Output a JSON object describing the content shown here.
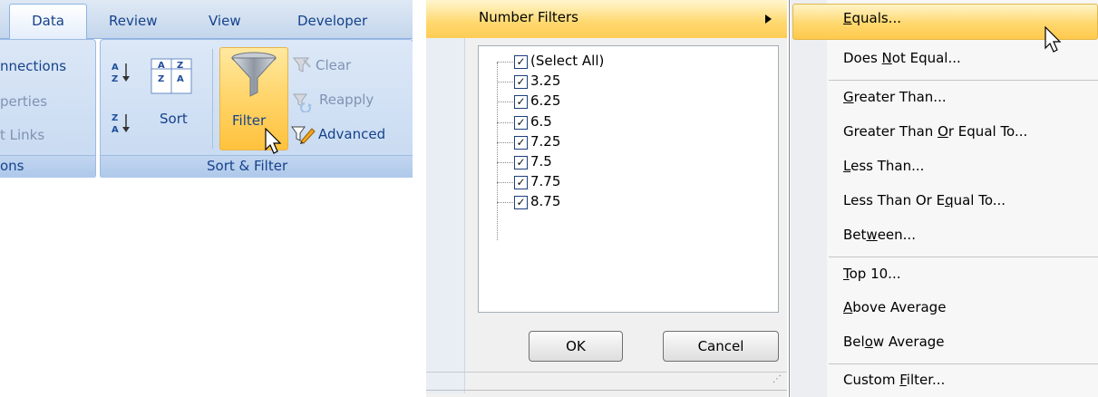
{
  "ribbon": {
    "tabs": [
      "Data",
      "Review",
      "View",
      "Developer"
    ],
    "connections_group": {
      "items": [
        "nnections",
        "perties",
        "t Links"
      ],
      "group_label": "ons"
    },
    "sort_filter_group": {
      "sort_label": "Sort",
      "filter_label": "Filter",
      "clear_label": "Clear",
      "reapply_label": "Reapply",
      "advanced_label": "Advanced",
      "group_label": "Sort & Filter"
    }
  },
  "filter_dropdown": {
    "number_filters_label": "Number Filters",
    "values": [
      {
        "label": "(Select All)",
        "checked": true
      },
      {
        "label": "3.25",
        "checked": true
      },
      {
        "label": "6.25",
        "checked": true
      },
      {
        "label": "6.5",
        "checked": true
      },
      {
        "label": "7.25",
        "checked": true
      },
      {
        "label": "7.5",
        "checked": true
      },
      {
        "label": "7.75",
        "checked": true
      },
      {
        "label": "8.75",
        "checked": true
      }
    ],
    "ok_label": "OK",
    "cancel_label": "Cancel"
  },
  "number_filters_menu": {
    "items": [
      {
        "label": "Equals...",
        "highlighted": true
      },
      {
        "label": "Does Not Equal..."
      },
      {
        "label": "Greater Than..."
      },
      {
        "label": "Greater Than Or Equal To..."
      },
      {
        "label": "Less Than..."
      },
      {
        "label": "Less Than Or Equal To..."
      },
      {
        "label": "Between..."
      },
      {
        "label": "Top 10..."
      },
      {
        "label": "Above Average"
      },
      {
        "label": "Below Average"
      },
      {
        "label": "Custom Filter..."
      }
    ]
  },
  "colors": {
    "ribbon_text": "#15428b",
    "highlight": "#ffd86e",
    "group_bg": "#c6d9f1"
  }
}
